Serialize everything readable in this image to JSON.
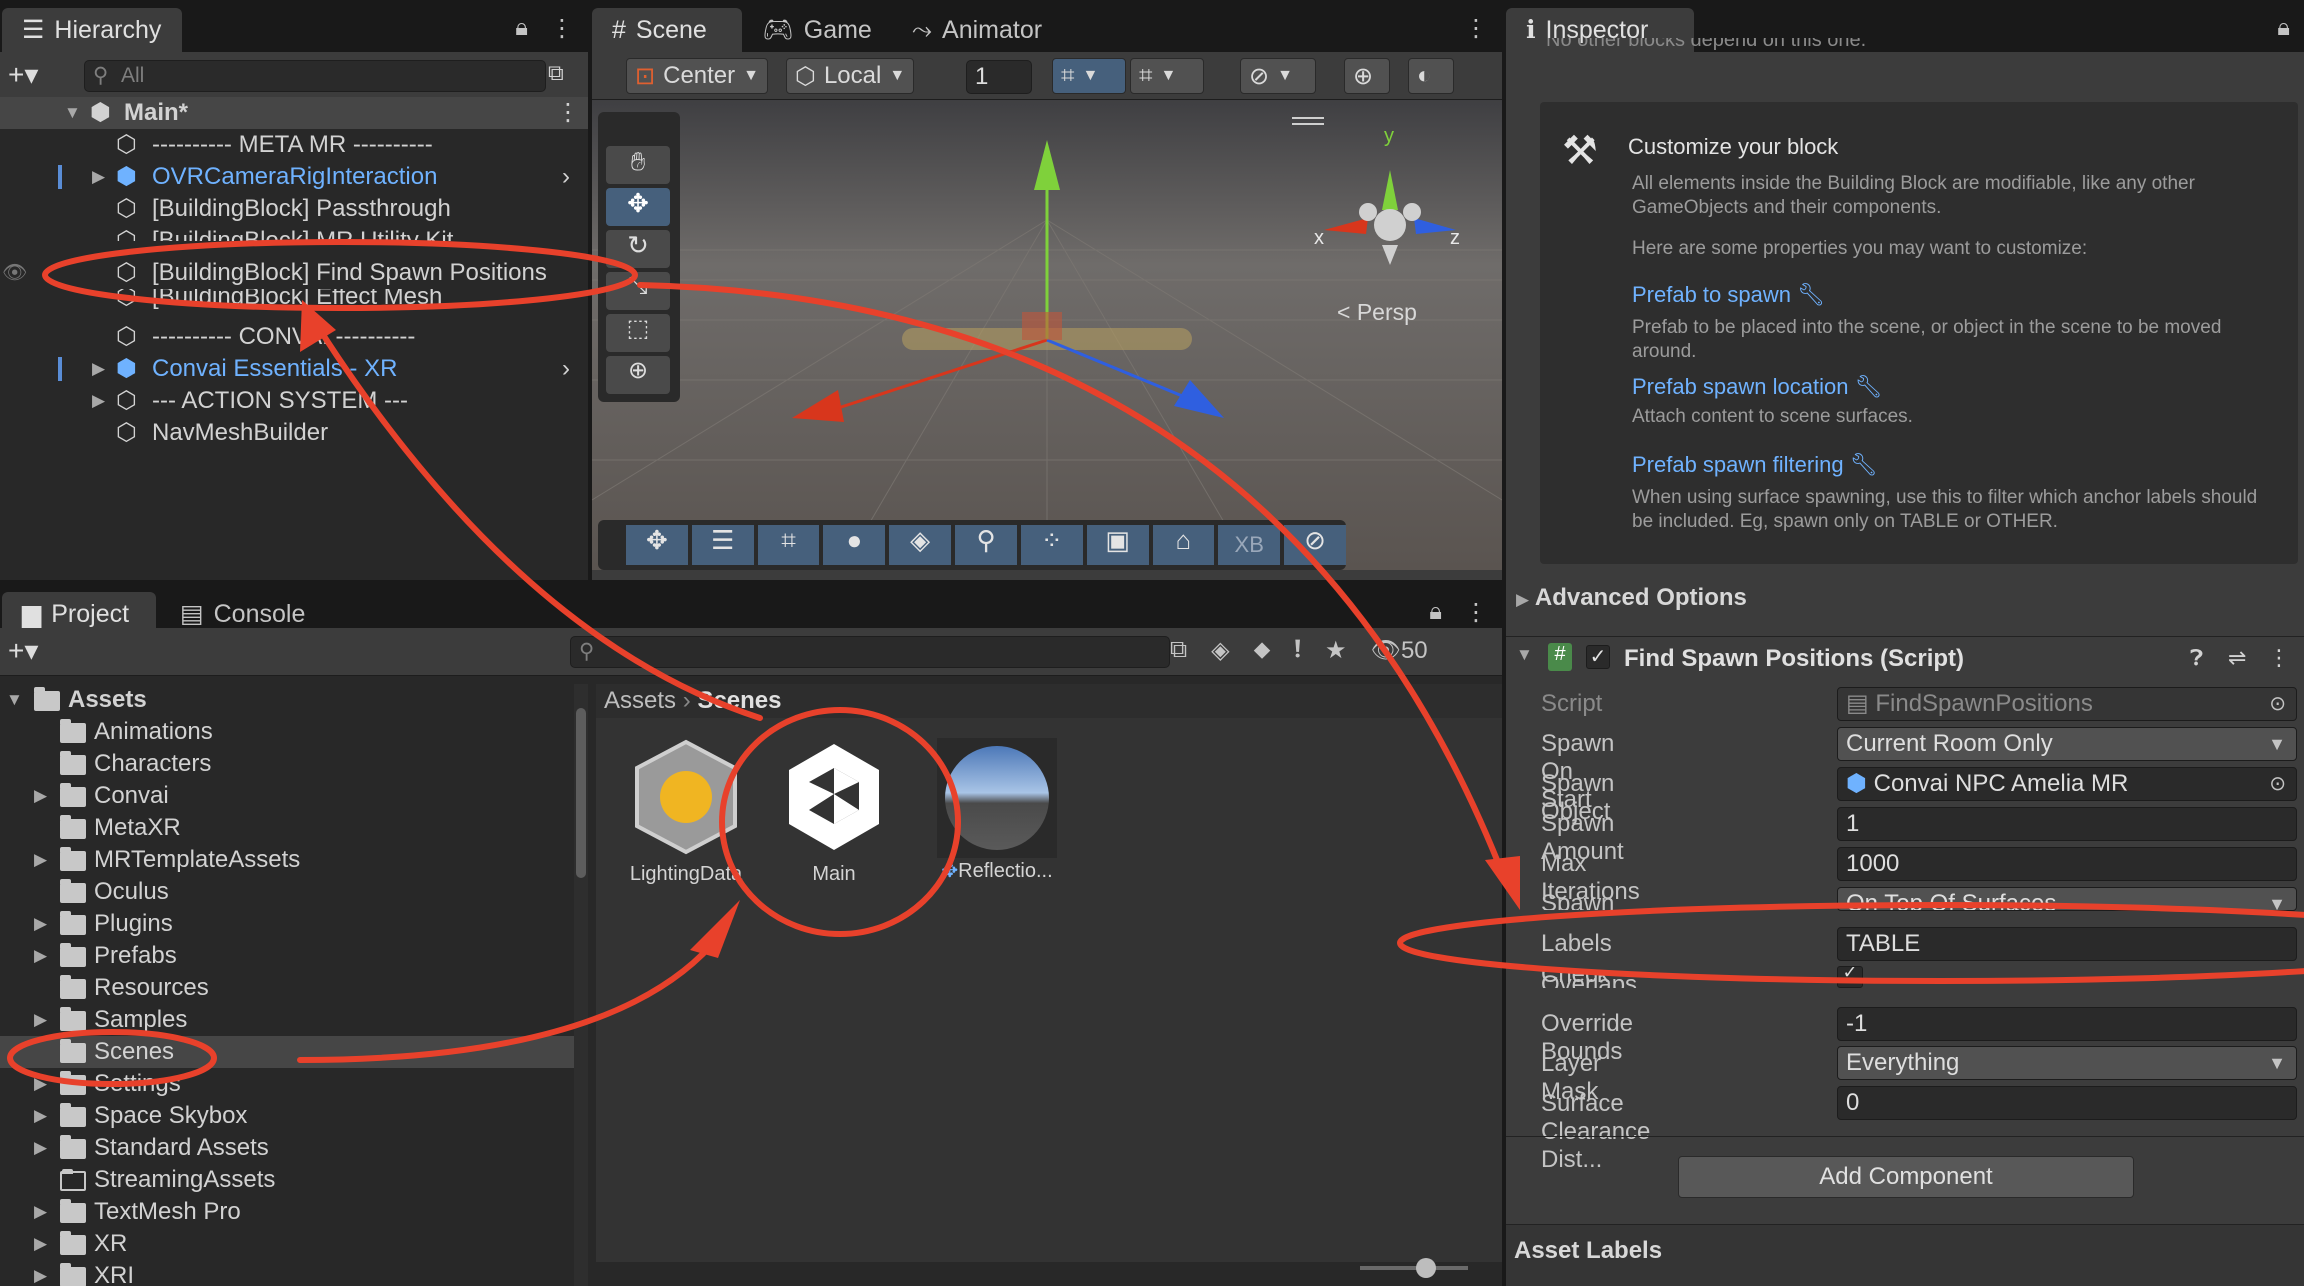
{
  "hierarchy": {
    "tab": "Hierarchy",
    "search_placeholder": "All",
    "scene": "Main*",
    "items": [
      {
        "label": "---------- META MR ----------"
      },
      {
        "label": "OVRCameraRigInteraction"
      },
      {
        "label": "[BuildingBlock] Passthrough"
      },
      {
        "label": "[BuildingBlock] MR Utility Kit"
      },
      {
        "label": "[BuildingBlock] Find Spawn Positions"
      },
      {
        "label": "[BuildingBlock] Effect Mesh"
      },
      {
        "label": "---------- CONVAI ----------"
      },
      {
        "label": "Convai Essentials - XR"
      },
      {
        "label": "--- ACTION SYSTEM ---"
      },
      {
        "label": "NavMeshBuilder"
      }
    ]
  },
  "scene_view": {
    "tabs": [
      "Scene",
      "Game",
      "Animator"
    ],
    "pivot": "Center",
    "space": "Local",
    "grid_value": "1",
    "persp": "Persp",
    "gizmo_axes": {
      "x": "x",
      "y": "y",
      "z": "z"
    },
    "overlay_label": "XB"
  },
  "project": {
    "tabs": [
      "Project",
      "Console"
    ],
    "hidden_count": "50",
    "breadcrumb": [
      "Assets",
      "Scenes"
    ],
    "tree": [
      {
        "label": "Assets"
      },
      {
        "label": "Animations"
      },
      {
        "label": "Characters"
      },
      {
        "label": "Convai"
      },
      {
        "label": "MetaXR"
      },
      {
        "label": "MRTemplateAssets"
      },
      {
        "label": "Oculus"
      },
      {
        "label": "Plugins"
      },
      {
        "label": "Prefabs"
      },
      {
        "label": "Resources"
      },
      {
        "label": "Samples"
      },
      {
        "label": "Scenes"
      },
      {
        "label": "Settings"
      },
      {
        "label": "Space Skybox"
      },
      {
        "label": "Standard Assets"
      },
      {
        "label": "StreamingAssets"
      },
      {
        "label": "TextMesh Pro"
      },
      {
        "label": "XR"
      },
      {
        "label": "XRI"
      }
    ],
    "assets": [
      {
        "label": "LightingData"
      },
      {
        "label": "Main"
      },
      {
        "label": "Reflectio..."
      }
    ]
  },
  "inspector": {
    "tab": "Inspector",
    "top_cut_text": "No other blocks depend on this one.",
    "customize": {
      "title": "Customize your block",
      "intro": "All elements inside the Building Block are modifiable, like any other GameObjects and their components.",
      "intro2": "Here are some properties you may want to customize:",
      "links": [
        {
          "label": "Prefab to spawn",
          "desc": "Prefab to be placed into the scene, or object in the scene to be moved around."
        },
        {
          "label": "Prefab spawn location",
          "desc": "Attach content to scene surfaces."
        },
        {
          "label": "Prefab spawn filtering",
          "desc": "When using surface spawning, use this to filter which anchor labels should be included. Eg, spawn only on TABLE or OTHER."
        }
      ]
    },
    "advanced": "Advanced Options",
    "component_title": "Find Spawn Positions (Script)",
    "props": [
      {
        "label": "Script",
        "value": "FindSpawnPositions"
      },
      {
        "label": "Spawn On Start",
        "value": "Current Room Only"
      },
      {
        "label": "Spawn Object",
        "value": "Convai NPC Amelia MR"
      },
      {
        "label": "Spawn Amount",
        "value": "1"
      },
      {
        "label": "Max Iterations",
        "value": "1000"
      },
      {
        "label": "Spawn Locations",
        "value": "On Top Of Surfaces"
      },
      {
        "label": "Labels",
        "value": "TABLE"
      },
      {
        "label": "Check Overlaps",
        "value": "✓"
      },
      {
        "label": "Override Bounds",
        "value": "-1"
      },
      {
        "label": "Layer Mask",
        "value": "Everything"
      },
      {
        "label": "Surface Clearance Dist...",
        "value": "0"
      }
    ],
    "add_component": "Add Component",
    "asset_labels": "Asset Labels"
  },
  "colors": {
    "annotation": "#e8412b",
    "link": "#6fb2ff",
    "selection": "#2c5d87"
  }
}
